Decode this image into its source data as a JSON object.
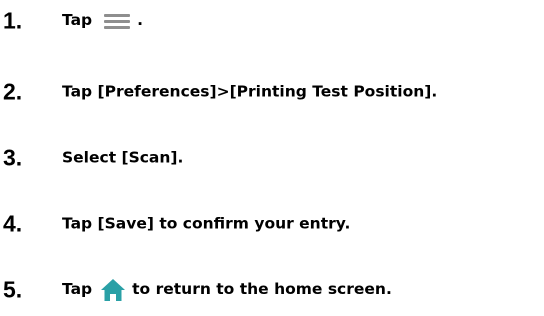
{
  "steps": [
    {
      "number": "1.",
      "before": "Tap",
      "after": ".",
      "icon": "menu-icon"
    },
    {
      "number": "2.",
      "text": "Tap [Preferences]>[Printing Test Position]."
    },
    {
      "number": "3.",
      "text": "Select [Scan]."
    },
    {
      "number": "4.",
      "text": "Tap [Save] to confirm your entry."
    },
    {
      "number": "5.",
      "before": "Tap",
      "after": "to return to the home screen.",
      "icon": "home-icon"
    }
  ],
  "colors": {
    "text": "#000000",
    "menu_icon": "#8e8e8e",
    "home_icon": "#2aa0a6"
  }
}
